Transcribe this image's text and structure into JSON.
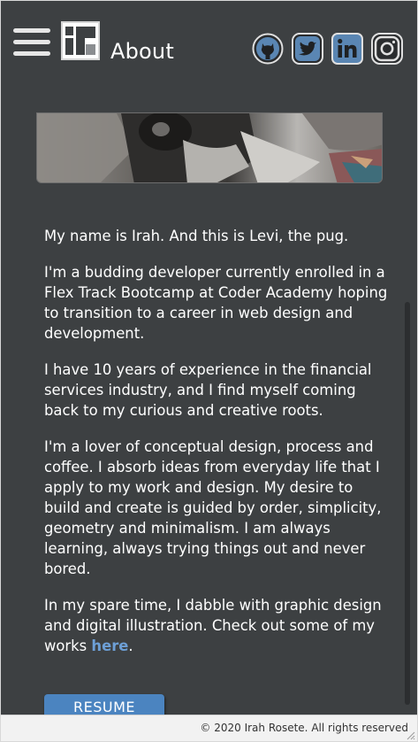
{
  "header": {
    "title": "About",
    "menu_icon": "hamburger-menu-icon",
    "logo_icon": "ir-logo-icon",
    "social": [
      {
        "name": "github",
        "icon": "github-icon"
      },
      {
        "name": "twitter",
        "icon": "twitter-icon"
      },
      {
        "name": "linkedin",
        "icon": "linkedin-icon"
      },
      {
        "name": "instagram",
        "icon": "instagram-icon"
      }
    ]
  },
  "about": {
    "p1": "My name is Irah. And this is Levi, the pug.",
    "p2": "I'm a budding developer currently enrolled in a Flex Track Bootcamp at Coder Academy hoping to transition to a career in web design and development.",
    "p3": "I have 10 years of experience in the financial services industry, and I find myself coming back to my curious and creative roots.",
    "p4": "I'm a lover of conceptual design, process and coffee. I absorb ideas from everyday life that I apply to my work and design. My desire to build and create is guided by order, simplicity, geometry and minimalism. I am always learning, always trying things out and never bored.",
    "p5_before": "In my spare time, I dabble with graphic design and digital illustration. Check out some of my works ",
    "p5_link": "here",
    "p5_after": "."
  },
  "resume_label": "RESUME",
  "footer": {
    "copyright": "© 2020 Irah Rosete. All rights reserved"
  },
  "colors": {
    "background": "#3d4042",
    "accent": "#4b84c0",
    "link": "#6d9fd6",
    "social_badge": "#5a86b3"
  }
}
